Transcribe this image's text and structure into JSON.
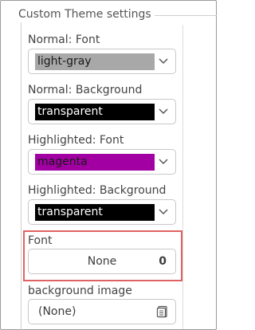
{
  "group": {
    "title": "Custom Theme settings"
  },
  "normal_font": {
    "label": "Normal: Font",
    "value": "light-gray",
    "swatch_color": "#a8a8a8",
    "text_color": "#1a1a1a"
  },
  "normal_background": {
    "label": "Normal: Background",
    "value": "transparent",
    "swatch_color": "#000000",
    "text_color": "#ffffff"
  },
  "highlighted_font": {
    "label": "Highlighted: Font",
    "value": "magenta",
    "swatch_color": "#a200a2",
    "text_color": "#1a1a1a"
  },
  "highlighted_background": {
    "label": "Highlighted: Background",
    "value": "transparent",
    "swatch_color": "#000000",
    "text_color": "#ffffff"
  },
  "font": {
    "label": "Font",
    "name": "None",
    "size": "0",
    "highlight_color": "#e06262"
  },
  "background_image": {
    "label": "background image",
    "value": "(None)",
    "icon": "file-open-icon"
  }
}
